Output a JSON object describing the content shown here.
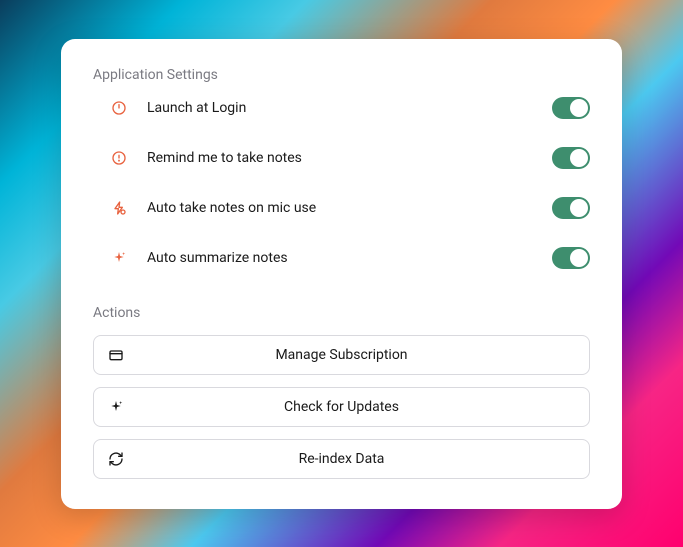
{
  "sections": {
    "settings": {
      "title": "Application Settings",
      "items": [
        {
          "label": "Launch at Login",
          "enabled": true
        },
        {
          "label": "Remind me to take notes",
          "enabled": true
        },
        {
          "label": "Auto take notes on mic use",
          "enabled": true
        },
        {
          "label": "Auto summarize notes",
          "enabled": true
        }
      ]
    },
    "actions": {
      "title": "Actions",
      "items": [
        {
          "label": "Manage Subscription"
        },
        {
          "label": "Check for Updates"
        },
        {
          "label": "Re-index Data"
        }
      ]
    }
  }
}
